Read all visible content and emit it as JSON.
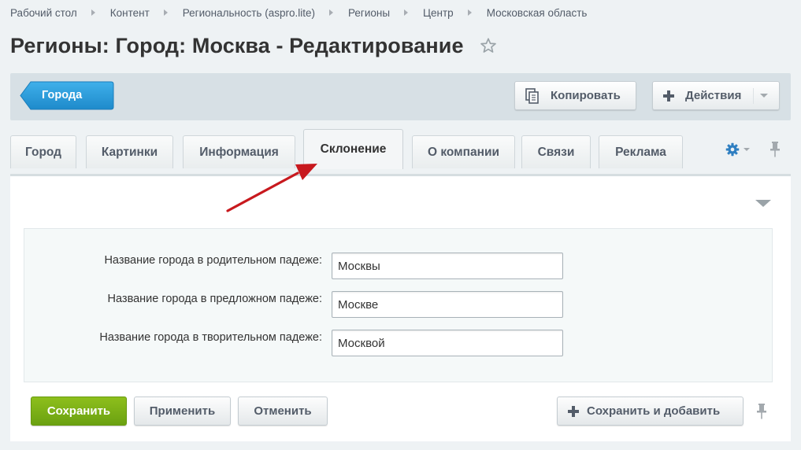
{
  "breadcrumb": {
    "items": [
      "Рабочий стол",
      "Контент",
      "Региональность (aspro.lite)",
      "Регионы",
      "Центр",
      "Московская область"
    ]
  },
  "page": {
    "title": "Регионы: Город: Москва - Редактирование"
  },
  "toolbar": {
    "back_label": "Города",
    "copy_label": "Копировать",
    "actions_label": "Действия"
  },
  "tabs": {
    "items": [
      {
        "label": "Город"
      },
      {
        "label": "Картинки"
      },
      {
        "label": "Информация"
      },
      {
        "label": "Склонение"
      },
      {
        "label": "О компании"
      },
      {
        "label": "Связи"
      },
      {
        "label": "Реклама"
      }
    ],
    "active": "Склонение"
  },
  "form": {
    "fields": [
      {
        "label": "Название города в родительном падеже:",
        "value": "Москвы"
      },
      {
        "label": "Название города в предложном падеже:",
        "value": "Москве"
      },
      {
        "label": "Название города в творительном падеже:",
        "value": "Москвой"
      }
    ]
  },
  "buttons": {
    "save": "Сохранить",
    "apply": "Применить",
    "cancel": "Отменить",
    "save_add": "Сохранить и добавить"
  },
  "colors": {
    "back_button": "#2f9ad8",
    "save_button": "#7cb116",
    "annotation_arrow": "#c8191e",
    "gear": "#2f7fc1"
  }
}
